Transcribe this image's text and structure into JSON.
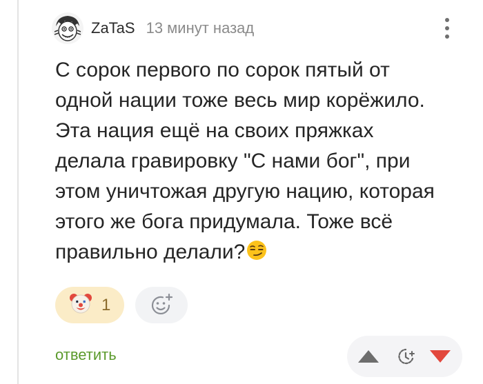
{
  "comment": {
    "author": "ZaTaS",
    "time_ago": "13 минут назад",
    "avatar_icon": "avatar-cartoon-face",
    "menu_icon": "vertical-dots-icon",
    "text_lines": [
      "С сорок первого по сорок пятый от",
      "одной нации тоже весь мир корёжило.",
      "Эта нация ещё на своих пряжках",
      "делала гравировку \"С нами бог\", при",
      "этом уничтожая другую нацию, которая",
      "этого же бога придумала. Тоже всё",
      "правильно делали?"
    ],
    "trailing_emoji": "smirking-face-emoji"
  },
  "reactions": {
    "items": [
      {
        "icon": "clown-face-emoji",
        "count": "1"
      }
    ],
    "add_icon": "add-reaction-icon"
  },
  "footer": {
    "reply_label": "ответить",
    "vote_up_icon": "triangle-up-icon",
    "save_later_icon": "clock-plus-icon",
    "vote_down_icon": "triangle-down-icon"
  },
  "colors": {
    "reply_green": "#5b9a2c",
    "downvote_red": "#e2483d",
    "upvote_gray": "#6d6d6d",
    "reaction_bg": "#fbecc7"
  }
}
